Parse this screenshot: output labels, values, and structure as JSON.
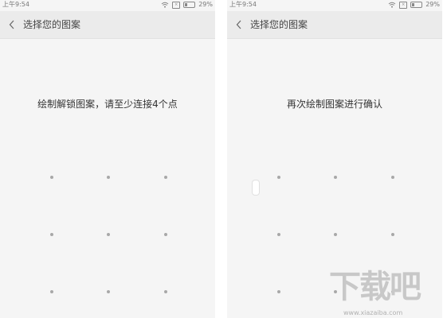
{
  "screens": [
    {
      "status": {
        "time": "上午9:54",
        "battery": "29%",
        "sim_icon": "sim-icon",
        "wifi_icon": "wifi-icon",
        "battery_icon": "battery-icon"
      },
      "title": "选择您的图案",
      "back_icon": "chevron-left-icon",
      "instruction": "绘制解锁图案，请至少连接4个点",
      "grid": {
        "rows": 3,
        "cols": 3
      }
    },
    {
      "status": {
        "time": "上午9:54",
        "battery": "29%",
        "sim_icon": "sim-icon",
        "wifi_icon": "wifi-icon",
        "battery_icon": "battery-icon"
      },
      "title": "选择您的图案",
      "back_icon": "chevron-left-icon",
      "instruction": "再次绘制图案进行确认",
      "grid": {
        "rows": 3,
        "cols": 3
      }
    }
  ],
  "watermark": {
    "logo": "下载吧",
    "url": "www.xiazaiba.com"
  },
  "colors": {
    "title_bar": "#ebebeb",
    "screen_bg": "#f5f5f5",
    "dot": "#a8a8a8",
    "text": "#333333"
  }
}
